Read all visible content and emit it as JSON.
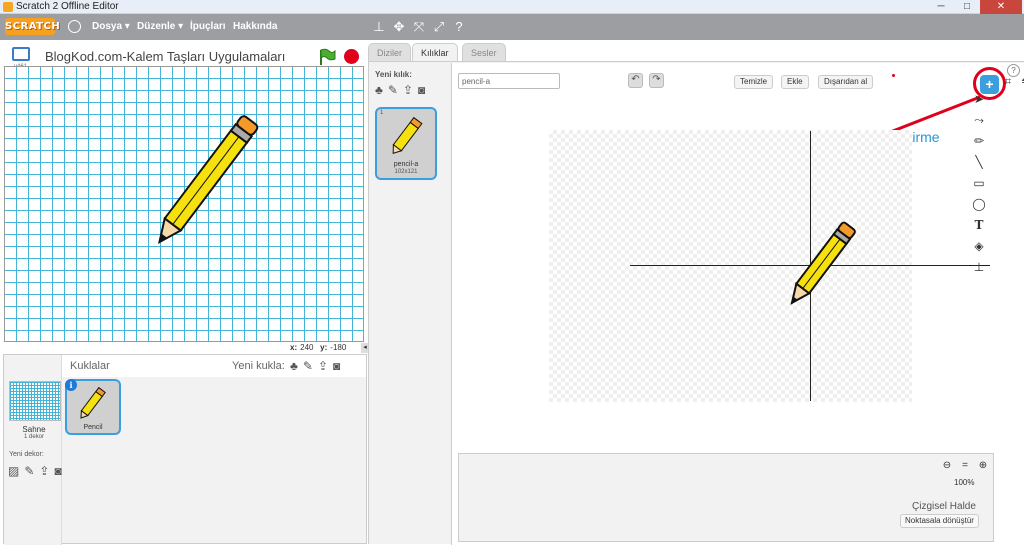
{
  "window": {
    "title": "Scratch 2 Offline Editor",
    "minimize": "─",
    "maximize": "□",
    "close": "✕"
  },
  "menubar": {
    "logo": "SCRATCH",
    "items": [
      "Dosya ▾",
      "Düzenle ▾",
      "İpuçları",
      "Hakkında"
    ],
    "icons": [
      "stamp-icon",
      "shrink-icon",
      "expand-icon",
      "grow-icon",
      "help-icon"
    ]
  },
  "stage": {
    "version": "v461",
    "project_title": "BlogKod.com-Kalem Taşları Uygulamaları",
    "coords": {
      "x_label": "x:",
      "x_value": "240",
      "y_label": "y:",
      "y_value": "-180"
    }
  },
  "sprites_pane": {
    "title": "Kuklalar",
    "new_sprite_label": "Yeni kukla:",
    "stage_label": "Sahne",
    "stage_count": "1 dekor",
    "new_backdrop_label": "Yeni dekor:",
    "sprites": [
      {
        "name": "Pencil"
      }
    ]
  },
  "tabs": [
    "Diziler",
    "Kılıklar",
    "Sesler"
  ],
  "costumes": {
    "new_costume_label": "Yeni kılık:",
    "items": [
      {
        "number": "1",
        "name": "pencil-a",
        "size": "102x121"
      }
    ]
  },
  "paint_editor": {
    "costume_name": "pencil-a",
    "buttons": {
      "clear": "Temizle",
      "add": "Ekle",
      "import": "Dışarıdan al"
    },
    "annotation": "Kılık merkezini aktifleştirme",
    "zoom_level": "100%",
    "mode": "Çizgisel Halde",
    "convert_button": "Noktasala dönüştür"
  },
  "colors": {
    "menubar": "#9c9ea2",
    "accent": "#3a9fdc",
    "grid": "#43b4d6",
    "stop": "#e0001b",
    "annotation": "#2696d3"
  }
}
